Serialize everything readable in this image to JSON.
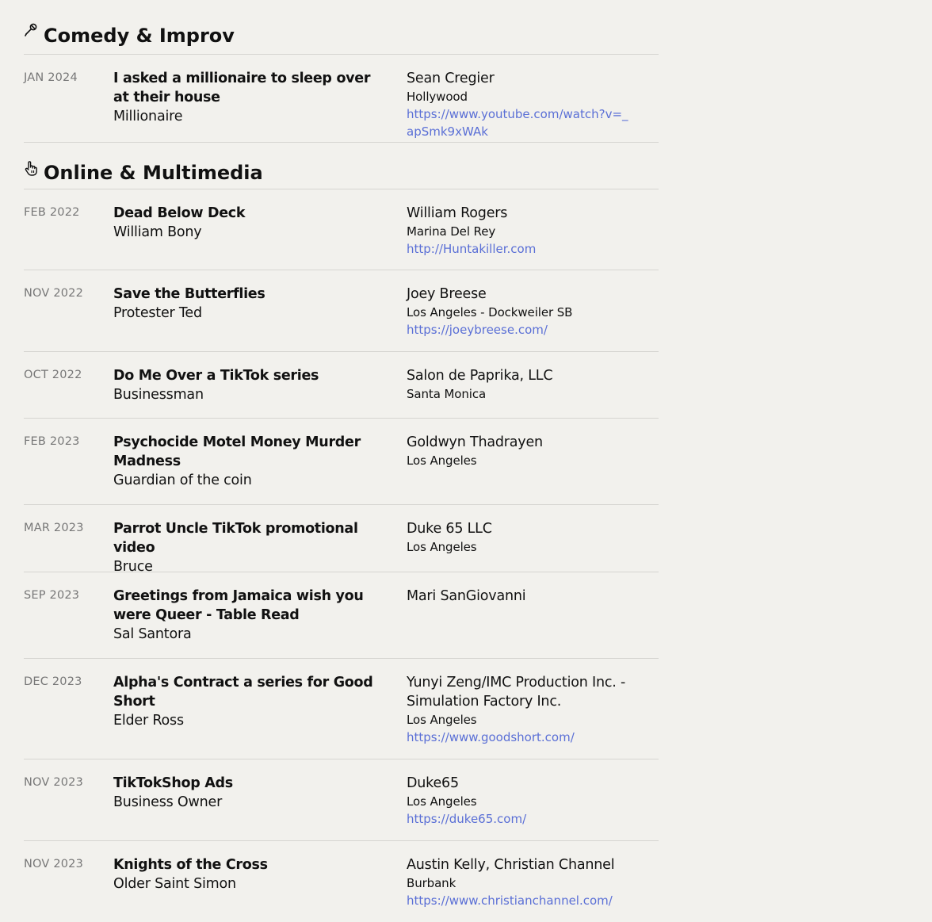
{
  "sections": [
    {
      "icon": "microphone-icon",
      "heading": "Comedy & Improv",
      "entries": [
        {
          "date": "JAN 2024",
          "title": "I asked a millionaire to sleep over at their house",
          "role": "Millionaire",
          "company": "Sean Cregier",
          "location": "Hollywood",
          "link": "https://www.youtube.com/watch?v=_apSmk9xWAk"
        }
      ]
    },
    {
      "icon": "hand-pointer-icon",
      "heading": "Online & Multimedia",
      "entries": [
        {
          "date": "FEB 2022",
          "title": "Dead Below Deck",
          "role": "William Bony",
          "company": "William Rogers",
          "location": "Marina Del Rey",
          "link": "http://Huntakiller.com"
        },
        {
          "date": "NOV 2022",
          "title": "Save the Butterflies",
          "role": "Protester Ted",
          "company": "Joey Breese",
          "location": "Los Angeles - Dockweiler SB",
          "link": "https://joeybreese.com/"
        },
        {
          "date": "OCT 2022",
          "title": "Do Me Over a TikTok series",
          "role": "Businessman",
          "company": "Salon de Paprika, LLC",
          "location": "Santa Monica",
          "link": ""
        },
        {
          "date": "FEB 2023",
          "title": "Psychocide Motel Money Murder Madness",
          "role": "Guardian of the coin",
          "company": "Goldwyn Thadrayen",
          "location": "Los Angeles",
          "link": ""
        },
        {
          "date": "MAR 2023",
          "title": "Parrot Uncle TikTok promotional video",
          "role": "Bruce",
          "company": "Duke 65 LLC",
          "location": "Los Angeles",
          "link": ""
        },
        {
          "date": "SEP 2023",
          "title": "Greetings from Jamaica wish you were Queer - Table Read",
          "role": "Sal Santora",
          "company": "Mari SanGiovanni",
          "location": "",
          "link": ""
        },
        {
          "date": "DEC 2023",
          "title": "Alpha's Contract a series for Good Short",
          "role": "Elder Ross",
          "company": "Yunyi Zeng/IMC Production Inc. - Simulation Factory Inc.",
          "location": "Los Angeles",
          "link": "https://www.goodshort.com/"
        },
        {
          "date": "NOV 2023",
          "title": "TikTokShop Ads",
          "role": "Business Owner",
          "company": "Duke65",
          "location": "Los Angeles",
          "link": "https://duke65.com/"
        },
        {
          "date": "NOV 2023",
          "title": "Knights of the Cross",
          "role": "Older Saint Simon",
          "company": "Austin Kelly, Christian Channel",
          "location": "Burbank",
          "link": "https://www.christianchannel.com/"
        }
      ]
    }
  ],
  "colors": {
    "background": "#f2f1ed",
    "link": "#5a6fd6",
    "date": "#777777",
    "divider": "#d6d5d1"
  }
}
